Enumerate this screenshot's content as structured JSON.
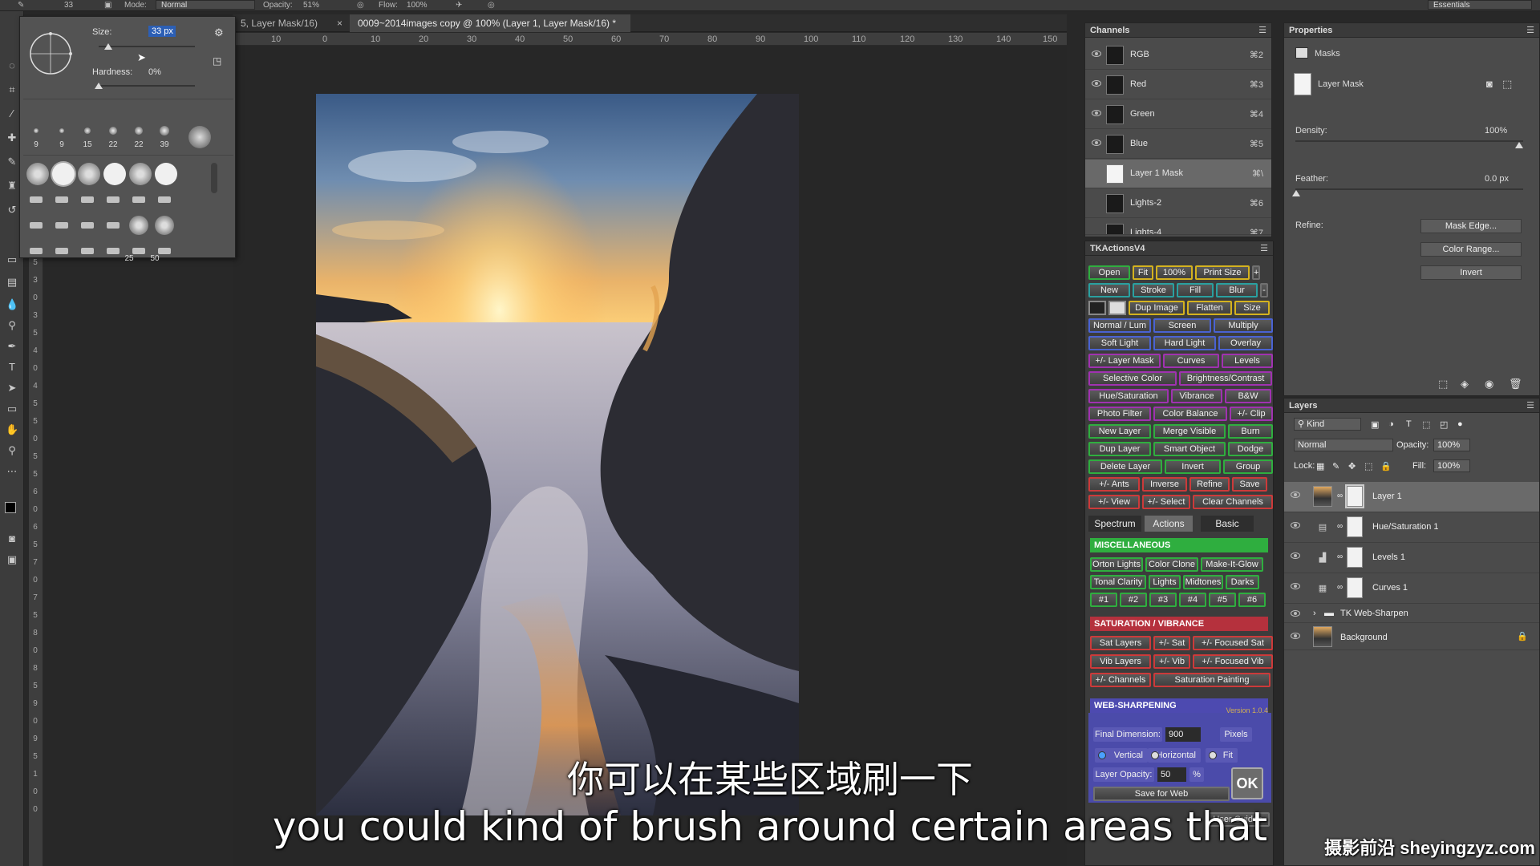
{
  "optionbar": {
    "brush_size_small": "33",
    "mode_label": "Mode:",
    "mode_value": "Normal",
    "opacity_label": "Opacity:",
    "opacity_value": "51%",
    "flow_label": "Flow:",
    "flow_value": "100%",
    "workspace": "Essentials"
  },
  "tabs": [
    {
      "label": "5, Layer Mask/16) *"
    },
    {
      "label": "0009~2014images copy @ 100% (Layer 1, Layer Mask/16) *"
    }
  ],
  "hruler_ticks": [
    "10",
    "0",
    "10",
    "20",
    "30",
    "40",
    "50",
    "60",
    "70",
    "80",
    "90",
    "100",
    "110",
    "120",
    "130",
    "140",
    "150"
  ],
  "vruler_ticks": [
    "2",
    "5",
    "3",
    "0",
    "3",
    "5",
    "4",
    "0",
    "4",
    "5",
    "5",
    "0",
    "5",
    "5",
    "6",
    "0",
    "6",
    "5",
    "7",
    "0",
    "7",
    "5",
    "8",
    "0",
    "8",
    "5",
    "9",
    "0",
    "9",
    "5",
    "1",
    "0",
    "0"
  ],
  "brush_panel": {
    "size_label": "Size:",
    "size_value": "33 px",
    "hardness_label": "Hardness:",
    "hardness_value": "0%",
    "size_fraction": 0.1,
    "hardness_fraction": 0.0,
    "preset_row1_nums": [
      "9",
      "9",
      "15",
      "22",
      "22",
      "39"
    ],
    "preset_row4_nums": [
      "25",
      "50"
    ]
  },
  "channels": {
    "title": "Channels",
    "rows": [
      {
        "name": "RGB",
        "key": "⌘2"
      },
      {
        "name": "Red",
        "key": "⌘3"
      },
      {
        "name": "Green",
        "key": "⌘4"
      },
      {
        "name": "Blue",
        "key": "⌘5"
      },
      {
        "name": "Layer 1 Mask",
        "key": "⌘\\"
      },
      {
        "name": "Lights-2",
        "key": "⌘6"
      },
      {
        "name": "Lights-4",
        "key": "⌘7"
      }
    ]
  },
  "tk": {
    "title": "TKActionsV4",
    "row1": [
      "Open",
      "Fit",
      "100%",
      "Print Size",
      "+"
    ],
    "row2": [
      "New",
      "Stroke",
      "Fill",
      "Blur",
      "-"
    ],
    "row3": [
      "Dup Image",
      "Flatten",
      "Size"
    ],
    "row4": [
      "Normal / Lum",
      "Screen",
      "Multiply"
    ],
    "row5": [
      "Soft Light",
      "Hard Light",
      "Overlay"
    ],
    "row6": [
      "+/- Layer Mask",
      "Curves",
      "Levels"
    ],
    "row7": [
      "Selective Color",
      "Brightness/Contrast"
    ],
    "row8": [
      "Hue/Saturation",
      "Vibrance",
      "B&W"
    ],
    "row9": [
      "Photo Filter",
      "Color Balance",
      "+/- Clip"
    ],
    "row10": [
      "New Layer",
      "Merge Visible",
      "Burn"
    ],
    "row11": [
      "Dup Layer",
      "Smart Object",
      "Dodge"
    ],
    "row12": [
      "Delete Layer",
      "Invert",
      "Group"
    ],
    "row13": [
      "+/- Ants",
      "Inverse",
      "Refine",
      "Save"
    ],
    "row14": [
      "+/- View",
      "+/- Select",
      "Clear Channels"
    ],
    "subtabs": [
      "Spectrum",
      "Actions",
      "Basic"
    ],
    "misc_title": "MISCELLANEOUS",
    "misc1": [
      "Orton Lights",
      "Color Clone",
      "Make-It-Glow"
    ],
    "misc2": [
      "Tonal Clarity",
      "Lights",
      "Midtones",
      "Darks"
    ],
    "misc3": [
      "#1",
      "#2",
      "#3",
      "#4",
      "#5",
      "#6"
    ],
    "sat_title": "SATURATION / VIBRANCE",
    "sat1": [
      "Sat Layers",
      "+/- Sat",
      "+/- Focused Sat"
    ],
    "sat2": [
      "Vib Layers",
      "+/- Vib",
      "+/- Focused Vib"
    ],
    "sat3": [
      "+/- Channels",
      "Saturation Painting"
    ],
    "web_title": "WEB-SHARPENING",
    "web_version": "Version 1.0.4",
    "final_dim_label": "Final Dimension:",
    "final_dim_value": "900",
    "pixels_label": "Pixels",
    "orient": [
      "Vertical",
      "Horizontal",
      "Fit"
    ],
    "layer_opacity_label": "Layer Opacity:",
    "layer_opacity_value": "50",
    "percent_label": "%",
    "save_for_web": "Save for Web",
    "ok": "OK",
    "user_guides": "User Guides"
  },
  "properties": {
    "title": "Properties",
    "masks_label": "Masks",
    "layer_mask_label": "Layer Mask",
    "density_label": "Density:",
    "density_value": "100%",
    "feather_label": "Feather:",
    "feather_value": "0.0 px",
    "refine_label": "Refine:",
    "buttons": [
      "Mask Edge...",
      "Color Range...",
      "Invert"
    ]
  },
  "layers": {
    "title": "Layers",
    "kind_label": "Kind",
    "blend_mode": "Normal",
    "opacity_label": "Opacity:",
    "opacity_value": "100%",
    "lock_label": "Lock:",
    "fill_label": "Fill:",
    "fill_value": "100%",
    "rows": [
      {
        "name": "Layer 1"
      },
      {
        "name": "Hue/Saturation 1"
      },
      {
        "name": "Levels 1"
      },
      {
        "name": "Curves 1"
      },
      {
        "name": "TK Web-Sharpen"
      },
      {
        "name": "Background"
      }
    ]
  },
  "subtitles": {
    "zh": "你可以在某些区域刷一下",
    "en": "you could kind of brush around certain areas that"
  },
  "watermark": "摄影前沿 sheyingzyz.com"
}
